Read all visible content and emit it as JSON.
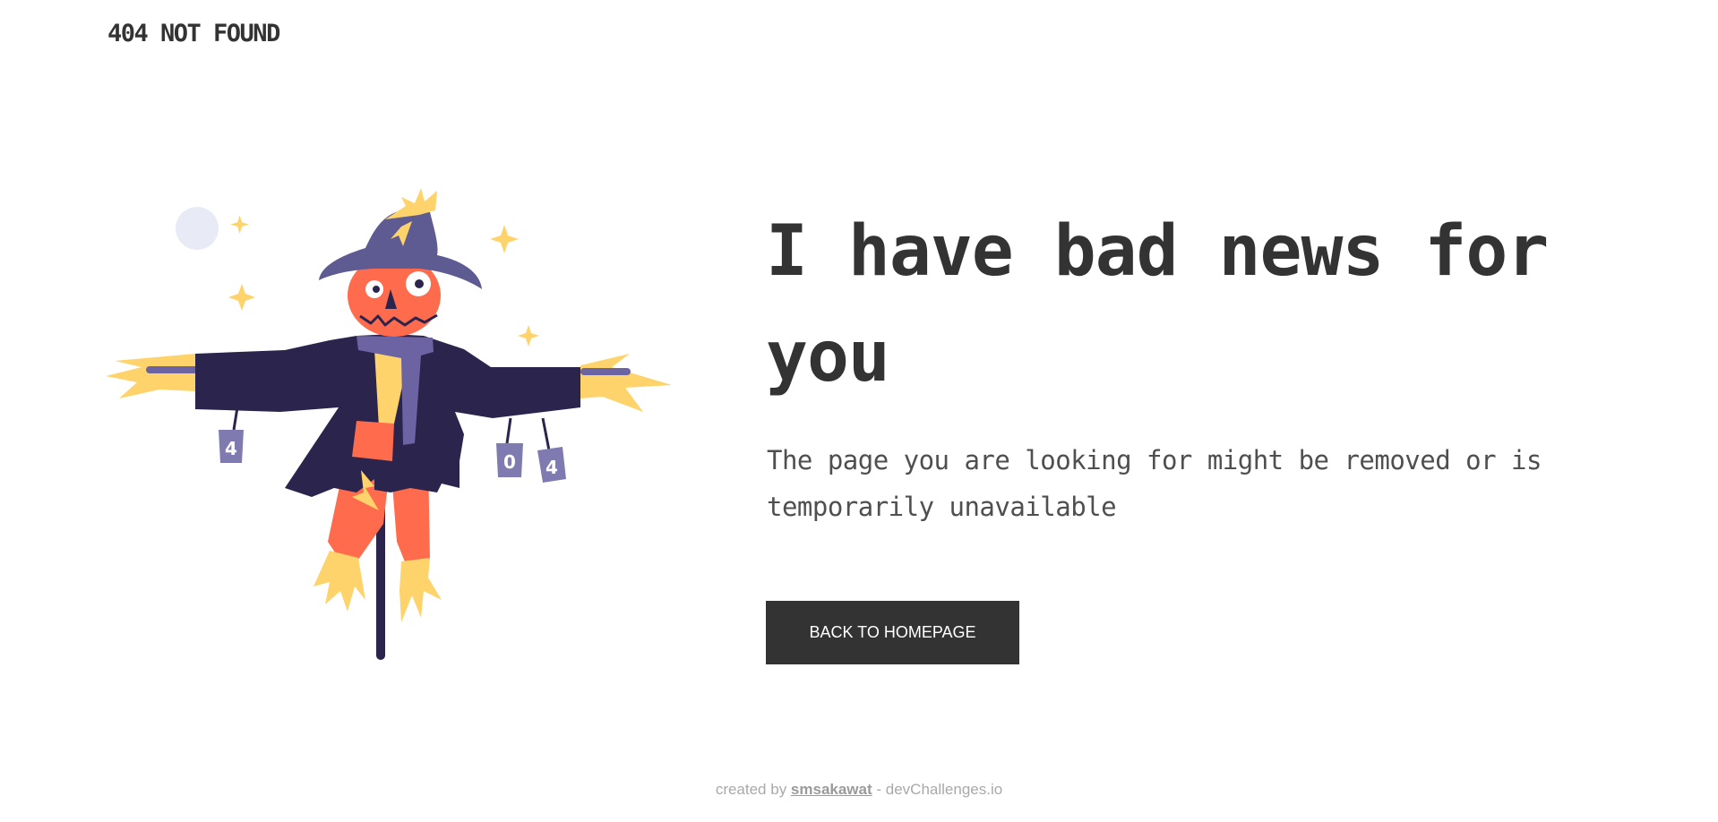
{
  "header": {
    "brand": "404 NOT FOUND"
  },
  "illustration": {
    "can_labels": [
      "4",
      "0",
      "4"
    ],
    "colors": {
      "coat": "#2b244d",
      "hat": "#5e5a92",
      "face": "#ff6b4d",
      "straw": "#ffd36b",
      "scarf": "#6c63a3",
      "moon": "#e8ebf5",
      "cans": "#7f7ab0"
    }
  },
  "main": {
    "headline": "I have bad news for you",
    "message": "The page you are looking for might be removed or is temporarily unavailable",
    "button_label": "BACK TO HOMEPAGE"
  },
  "footer": {
    "prefix": "created by ",
    "author": "smsakawat",
    "suffix": " - devChallenges.io"
  }
}
